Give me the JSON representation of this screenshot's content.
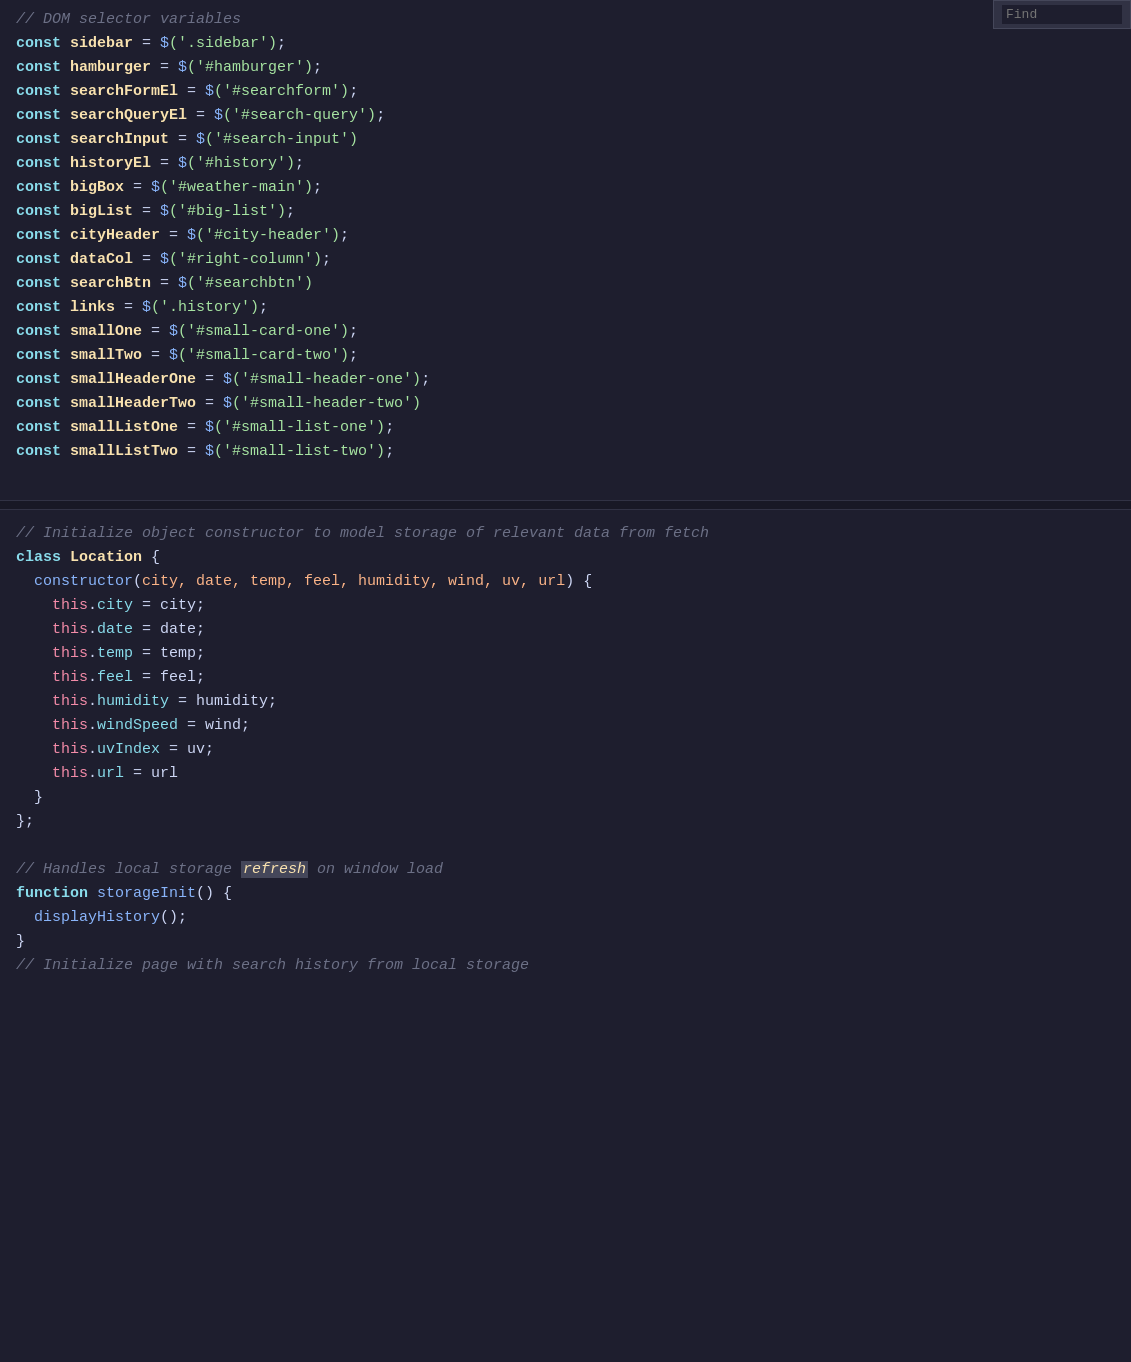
{
  "editor": {
    "background": "#1e1e2e",
    "find_placeholder": "Find"
  },
  "code": {
    "sections": [
      {
        "id": "dom-section",
        "comment": "// DOM selector variables",
        "lines": [
          {
            "keyword": "const",
            "variable": "sidebar",
            "operator": " = ",
            "func": "$",
            "selector": "('.sidebar')",
            "semi": ";"
          },
          {
            "keyword": "const",
            "variable": "hamburger",
            "operator": " = ",
            "func": "$",
            "selector": "('#hamburger')",
            "semi": ";"
          },
          {
            "keyword": "const",
            "variable": "searchFormEl",
            "operator": " = ",
            "func": "$",
            "selector": "('#searchform')",
            "semi": ";"
          },
          {
            "keyword": "const",
            "variable": "searchQueryEl",
            "operator": " = ",
            "func": "$",
            "selector": "('#search-query')",
            "semi": ";"
          },
          {
            "keyword": "const",
            "variable": "searchInput",
            "operator": " = ",
            "func": "$",
            "selector": "('#search-input')",
            "semi": ""
          },
          {
            "keyword": "const",
            "variable": "historyEl",
            "operator": " = ",
            "func": "$",
            "selector": "('#history')",
            "semi": ";"
          },
          {
            "keyword": "const",
            "variable": "bigBox",
            "operator": " = ",
            "func": "$",
            "selector": "('#weather-main')",
            "semi": ";"
          },
          {
            "keyword": "const",
            "variable": "bigList",
            "operator": " = ",
            "func": "$",
            "selector": "('#big-list')",
            "semi": ";"
          },
          {
            "keyword": "const",
            "variable": "cityHeader",
            "operator": " = ",
            "func": "$",
            "selector": "('#city-header')",
            "semi": ";"
          },
          {
            "keyword": "const",
            "variable": "dataCol",
            "operator": " = ",
            "func": "$",
            "selector": "('#right-column')",
            "semi": ";"
          },
          {
            "keyword": "const",
            "variable": "searchBtn",
            "operator": " = ",
            "func": "$",
            "selector": "('#searchbtn')",
            "semi": ""
          },
          {
            "keyword": "const",
            "variable": "links",
            "operator": " = ",
            "func": "$",
            "selector": "('.history')",
            "semi": ";"
          },
          {
            "keyword": "const",
            "variable": "smallOne",
            "operator": " = ",
            "func": "$",
            "selector": "('#small-card-one')",
            "semi": ";"
          },
          {
            "keyword": "const",
            "variable": "smallTwo",
            "operator": " = ",
            "func": "$",
            "selector": "('#small-card-two')",
            "semi": ";"
          },
          {
            "keyword": "const",
            "variable": "smallHeaderOne",
            "operator": " = ",
            "func": "$",
            "selector": "('#small-header-one')",
            "semi": ";"
          },
          {
            "keyword": "const",
            "variable": "smallHeaderTwo",
            "operator": " = ",
            "func": "$",
            "selector": "('#small-header-two')",
            "semi": ""
          },
          {
            "keyword": "const",
            "variable": "smallListOne",
            "operator": " = ",
            "func": "$",
            "selector": "('#small-list-one')",
            "semi": ";"
          },
          {
            "keyword": "const",
            "variable": "smallListTwo",
            "operator": " = ",
            "func": "$",
            "selector": "('#small-list-two')",
            "semi": ";"
          }
        ]
      },
      {
        "id": "class-section",
        "comment": "// Initialize object constructor to model storage of relevant data from fetch",
        "class_def": "class Location {",
        "constructor_sig": "  constructor(city, date, temp, feel, humidity, wind, uv, url) {",
        "this_lines": [
          "    this.city = city;",
          "    this.date = date;",
          "    this.temp = temp;",
          "    this.feel = feel;",
          "    this.humidity = humidity;",
          "    this.windSpeed = wind;",
          "    this.uvIndex = uv;",
          "    this.url = url"
        ],
        "close_constructor": "  }",
        "close_class": "};"
      },
      {
        "id": "storage-section",
        "comment1": "// Handles local storage refresh on window load",
        "func_def": "function storageInit() {",
        "func_body": "  displayHistory();",
        "close_func": "}",
        "comment2": "// Initialize page with search history from local storage"
      }
    ]
  }
}
